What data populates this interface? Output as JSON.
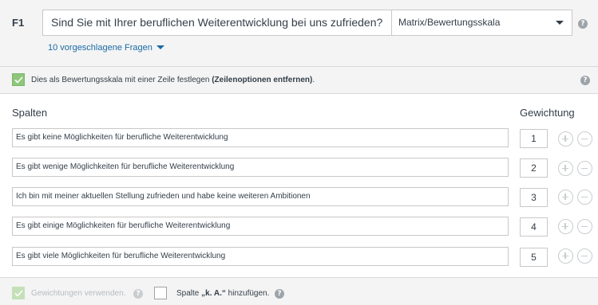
{
  "question": {
    "number": "F1",
    "text": "Sind Sie mit Ihrer beruflichen Weiterentwicklung bei uns zufrieden?",
    "type": "Matrix/Bewertungsskala",
    "suggestions_link": "10 vorgeschlagene Fragen"
  },
  "scale_option": {
    "checked": true,
    "text_prefix": "Dies als Bewertungsskala mit einer Zeile festlegen ",
    "text_bold": "(Zeilenoptionen entfernen)",
    "text_suffix": "."
  },
  "columns_section": {
    "header_label": "Spalten",
    "weight_header": "Gewichtung",
    "rows": [
      {
        "label": "Es gibt keine Möglichkeiten für berufliche Weiterentwicklung",
        "weight": "1"
      },
      {
        "label": "Es gibt wenige Möglichkeiten für berufliche Weiterentwicklung",
        "weight": "2"
      },
      {
        "label": "Ich bin mit meiner aktuellen Stellung zufrieden und habe keine weiteren Ambitionen",
        "weight": "3"
      },
      {
        "label": "Es gibt einige Möglichkeiten für berufliche Weiterentwicklung",
        "weight": "4"
      },
      {
        "label": "Es gibt viele Möglichkeiten für berufliche Weiterentwicklung",
        "weight": "5"
      }
    ]
  },
  "footer": {
    "use_weights_label": "Gewichtungen verwenden.",
    "use_weights_checked": true,
    "use_weights_disabled": true,
    "na_prefix": "Spalte ",
    "na_bold": "„k. A.“",
    "na_suffix": " hinzufügen.",
    "na_checked": false
  },
  "icons": {
    "help": "help-icon",
    "dropdown": "caret-down-icon",
    "add": "plus-circle-icon",
    "remove": "minus-circle-icon",
    "check": "checkmark-icon"
  },
  "colors": {
    "accent_green": "#8ec77b",
    "link_blue": "#1a6ba6",
    "panel_gray": "#f4f4f4"
  }
}
